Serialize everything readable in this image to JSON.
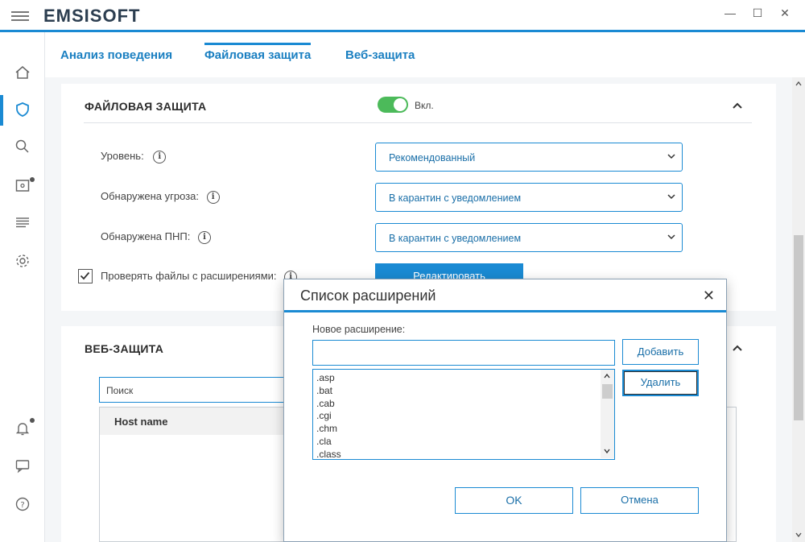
{
  "app": {
    "title": "EMSISOFT",
    "window_controls": [
      "—",
      "☐",
      "✕"
    ]
  },
  "sidebar": {
    "items": [
      "home-icon",
      "shield-icon",
      "search-icon",
      "quarantine-icon",
      "logs-icon",
      "settings-icon",
      "bell-icon",
      "chat-icon",
      "help-icon"
    ]
  },
  "tabs": [
    {
      "label": "Анализ поведения"
    },
    {
      "label": "Файловая защита"
    },
    {
      "label": "Веб-защита"
    }
  ],
  "file_protection": {
    "title": "ФАЙЛОВАЯ ЗАЩИТА",
    "toggle_label": "Вкл.",
    "level_label": "Уровень:",
    "level_value": "Рекомендованный",
    "threat_label": "Обнаружена угроза:",
    "threat_value": "В карантин с уведомлением",
    "pup_label": "Обнаружена ПНП:",
    "pup_value": "В карантин с уведомлением",
    "check_ext_label": "Проверять файлы с расширениями:",
    "edit_button": "Редактировать"
  },
  "web_protection": {
    "title": "ВЕБ-ЗАЩИТА",
    "search_placeholder": "Поиск",
    "column_host": "Host name"
  },
  "dialog": {
    "title": "Список расширений",
    "new_ext_label": "Новое расширение:",
    "new_ext_value": "",
    "add_button": "Добавить",
    "delete_button": "Удалить",
    "extensions": [
      ".asp",
      ".bat",
      ".cab",
      ".cgi",
      ".chm",
      ".cla",
      ".class"
    ],
    "ok_button": "OK",
    "cancel_button": "Отмена"
  },
  "colors": {
    "accent": "#1a8ad3",
    "toggle_on": "#4cba5a"
  }
}
